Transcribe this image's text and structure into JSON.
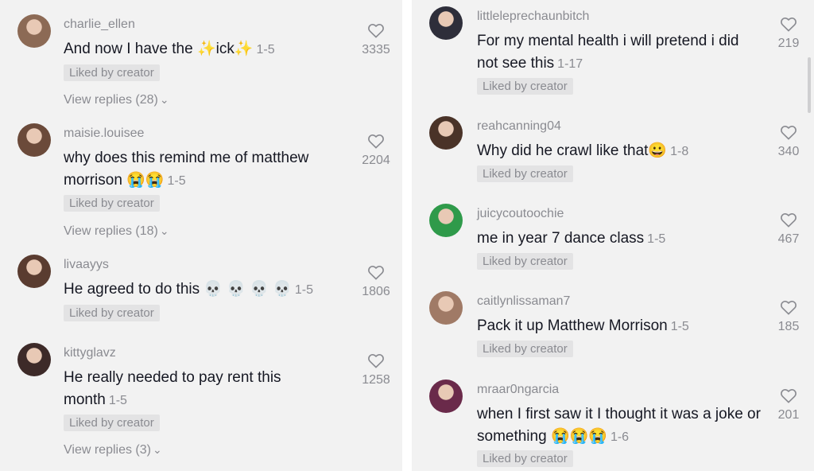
{
  "left": [
    {
      "username": "charlie_ellen",
      "text_parts": [
        "And now I have the ",
        "✨",
        "ick",
        "✨"
      ],
      "date": "1-5",
      "liked": "Liked by creator",
      "likes": "3335",
      "replies": "View replies (28)",
      "avatar_color": "#8c6a55"
    },
    {
      "username": "maisie.louisee",
      "text_parts": [
        "why does this remind me of matthew morrison ",
        "😭😭"
      ],
      "date": "1-5",
      "liked": "Liked by creator",
      "likes": "2204",
      "replies": "View replies (18)",
      "avatar_color": "#6b4a3a"
    },
    {
      "username": "livaayys",
      "text_parts": [
        "He agreed to do this ",
        "💀 💀 💀 💀"
      ],
      "date": "1-5",
      "liked": "Liked by creator",
      "likes": "1806",
      "replies": "",
      "avatar_color": "#5a3c30"
    },
    {
      "username": "kittyglavz",
      "text_parts": [
        "He really needed to pay rent this month"
      ],
      "date": "1-5",
      "liked": "Liked by creator",
      "likes": "1258",
      "replies": "View replies (3)",
      "avatar_color": "#3d2a28"
    }
  ],
  "right": [
    {
      "username": "littleleprechaunbitch",
      "text_parts": [
        "For my mental health i will pretend i did not see this"
      ],
      "date": "1-17",
      "liked": "Liked by creator",
      "likes": "219",
      "avatar_color": "#2e2e3a"
    },
    {
      "username": "reahcanning04",
      "text_parts": [
        "Why did he crawl like that",
        "😀"
      ],
      "date": "1-8",
      "liked": "Liked by creator",
      "likes": "340",
      "avatar_color": "#4a3328"
    },
    {
      "username": "juicycoutoochie",
      "text_parts": [
        "me in year 7 dance class"
      ],
      "date": "1-5",
      "liked": "Liked by creator",
      "likes": "467",
      "avatar_color": "#2f9a4a"
    },
    {
      "username": "caitlynlissaman7",
      "text_parts": [
        "Pack it up Matthew Morrison"
      ],
      "date": "1-5",
      "liked": "Liked by creator",
      "likes": "185",
      "avatar_color": "#a07a66"
    },
    {
      "username": "mraar0ngarcia",
      "text_parts": [
        "when I first saw it I thought it was a joke or something ",
        "😭😭😭"
      ],
      "date": "1-6",
      "liked": "Liked by creator",
      "likes": "201",
      "avatar_color": "#6a2a4a"
    }
  ],
  "icons": {
    "like": "heart-outline-icon",
    "expand": "chevron-down-icon"
  },
  "colors": {
    "background": "#f2f2f2",
    "muted": "#8a8b91",
    "badge": "#e3e3e4"
  }
}
